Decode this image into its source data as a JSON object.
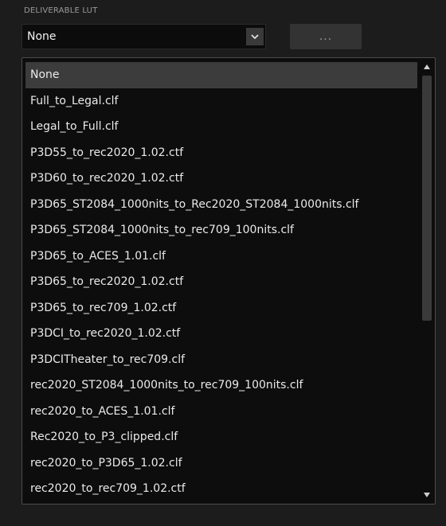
{
  "section": {
    "label": "DELIVERABLE LUT"
  },
  "select": {
    "value": "None",
    "arrow_icon": "chevron-down-icon"
  },
  "browse": {
    "label": "..."
  },
  "dropdown": {
    "selected_index": 0,
    "items": [
      "None",
      "Full_to_Legal.clf",
      "Legal_to_Full.clf",
      "P3D55_to_rec2020_1.02.ctf",
      "P3D60_to_rec2020_1.02.ctf",
      "P3D65_ST2084_1000nits_to_Rec2020_ST2084_1000nits.clf",
      "P3D65_ST2084_1000nits_to_rec709_100nits.clf",
      "P3D65_to_ACES_1.01.clf",
      "P3D65_to_rec2020_1.02.ctf",
      "P3D65_to_rec709_1.02.ctf",
      "P3DCI_to_rec2020_1.02.ctf",
      "P3DCITheater_to_rec709.clf",
      "rec2020_ST2084_1000nits_to_rec709_100nits.clf",
      "rec2020_to_ACES_1.01.clf",
      "Rec2020_to_P3_clipped.clf",
      "rec2020_to_P3D65_1.02.clf",
      "rec2020_to_rec709_1.02.ctf"
    ]
  },
  "colors": {
    "background": "#1c1c1c",
    "list_background": "#0d0d0d",
    "selected_row": "#3c3c3c",
    "text": "#eaeaea"
  }
}
